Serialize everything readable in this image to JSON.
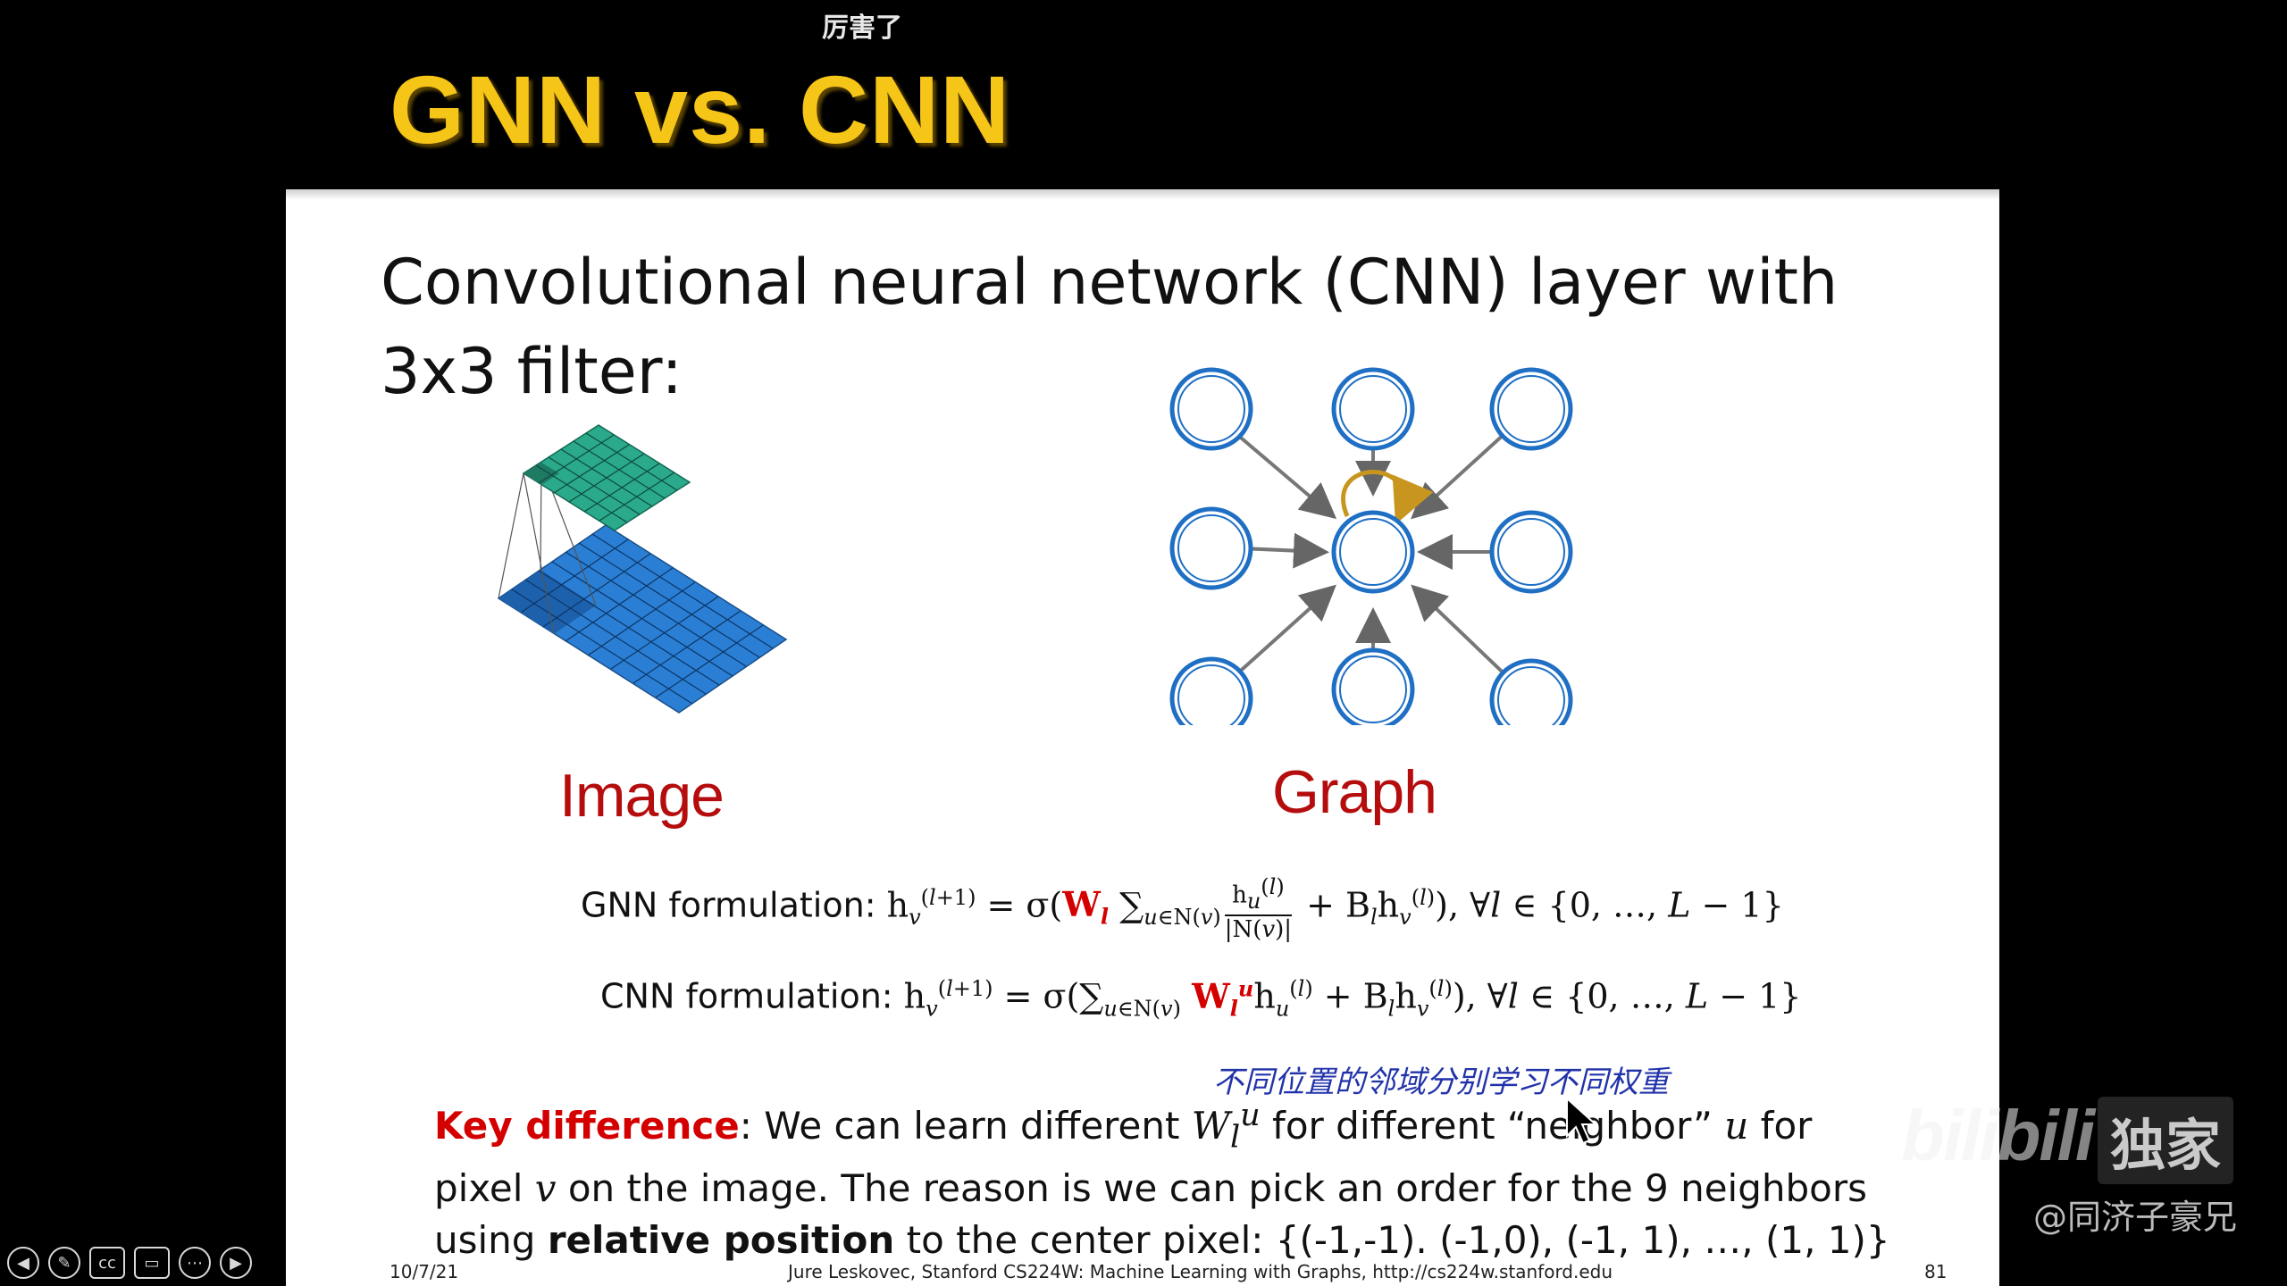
{
  "danmaku": "厉害了",
  "slide": {
    "title": "GNN vs. CNN",
    "headline_line1": "Convolutional neural network (CNN) layer with",
    "headline_line2": "3x3 filter:",
    "image_label": "Image",
    "graph_label": "Graph",
    "gnn_lead": "GNN formulation: ",
    "cnn_lead": "CNN formulation: ",
    "key_label": "Key difference",
    "key_text_1": ": We can learn different ",
    "key_text_2": " for different “neighbor” ",
    "key_text_3": " for pixel ",
    "key_text_4": " on the image. The reason is we can pick an order for the 9 neighbors using ",
    "key_bold_1": "relative position",
    "key_text_5": " to the center pixel: {(-1,-1). (-1,0), (-1, 1), …, (1, 1)}",
    "annotation": "不同位置的邻域分别学习不同权重",
    "footer_date": "10/7/21",
    "footer_credit": "Jure Leskovec, Stanford CS224W: Machine Learning with Graphs, http://cs224w.stanford.edu",
    "footer_page": "81"
  },
  "watermark": {
    "brand": "bilibili",
    "tag": "独家",
    "user": "@同济子豪兄"
  },
  "controls": [
    "prev-icon",
    "pen-icon",
    "cc-icon",
    "camera-off-icon",
    "more-icon",
    "next-icon"
  ],
  "colors": {
    "title": "#f5c518",
    "accent_red": "#b50d0d",
    "grid_blue": "#2a7fd4",
    "grid_teal": "#2aaa8a",
    "node_blue": "#1f6fc4",
    "self_loop": "#c8951f"
  }
}
